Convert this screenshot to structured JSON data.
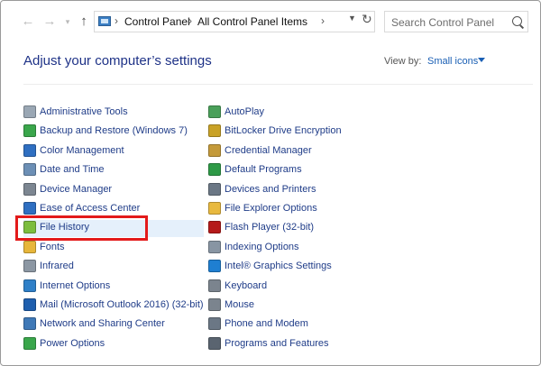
{
  "nav": {
    "back_icon": "arrow-left-icon",
    "forward_icon": "arrow-right-icon",
    "recent_icon": "chevron-down-icon",
    "up_icon": "arrow-up-icon"
  },
  "address": {
    "breadcrumbs": [
      "Control Panel",
      "All Control Panel Items"
    ],
    "separator": "›"
  },
  "search": {
    "placeholder": "Search Control Panel"
  },
  "header": {
    "title": "Adjust your computer’s settings",
    "view_by_label": "View by:",
    "view_by_value": "Small icons"
  },
  "items": {
    "left": [
      {
        "label": "Administrative Tools",
        "icon": "tools-gear-icon",
        "color": "#9aa7b4"
      },
      {
        "label": "Backup and Restore (Windows 7)",
        "icon": "backup-icon",
        "color": "#3aa64b"
      },
      {
        "label": "Color Management",
        "icon": "color-monitor-icon",
        "color": "#2f6fc1"
      },
      {
        "label": "Date and Time",
        "icon": "clock-calendar-icon",
        "color": "#6c8fb5"
      },
      {
        "label": "Device Manager",
        "icon": "device-manager-icon",
        "color": "#7c8691"
      },
      {
        "label": "Ease of Access Center",
        "icon": "ease-of-access-icon",
        "color": "#2f6fc1"
      },
      {
        "label": "File History",
        "icon": "file-history-icon",
        "color": "#7cbd3e"
      },
      {
        "label": "Fonts",
        "icon": "fonts-icon",
        "color": "#e7b63a"
      },
      {
        "label": "Infrared",
        "icon": "infrared-icon",
        "color": "#8c97a3"
      },
      {
        "label": "Internet Options",
        "icon": "globe-icon",
        "color": "#2f80c8"
      },
      {
        "label": "Mail (Microsoft Outlook 2016) (32-bit)",
        "icon": "mail-icon",
        "color": "#1f5fae"
      },
      {
        "label": "Network and Sharing Center",
        "icon": "network-icon",
        "color": "#3f79b7"
      },
      {
        "label": "Power Options",
        "icon": "power-icon",
        "color": "#3aa64b"
      }
    ],
    "right": [
      {
        "label": "AutoPlay",
        "icon": "autoplay-icon",
        "color": "#4aa05a"
      },
      {
        "label": "BitLocker Drive Encryption",
        "icon": "bitlocker-icon",
        "color": "#c9a227"
      },
      {
        "label": "Credential Manager",
        "icon": "credential-safe-icon",
        "color": "#c49a3a"
      },
      {
        "label": "Default Programs",
        "icon": "default-programs-icon",
        "color": "#2e9a47"
      },
      {
        "label": "Devices and Printers",
        "icon": "printer-icon",
        "color": "#6b7785"
      },
      {
        "label": "File Explorer Options",
        "icon": "folder-options-icon",
        "color": "#e8b93f"
      },
      {
        "label": "Flash Player (32-bit)",
        "icon": "flash-player-icon",
        "color": "#b51a1a"
      },
      {
        "label": "Indexing Options",
        "icon": "indexing-search-icon",
        "color": "#8895a3"
      },
      {
        "label": "Intel® Graphics Settings",
        "icon": "intel-graphics-icon",
        "color": "#1f7fd1"
      },
      {
        "label": "Keyboard",
        "icon": "keyboard-icon",
        "color": "#7b848e"
      },
      {
        "label": "Mouse",
        "icon": "mouse-icon",
        "color": "#7b848e"
      },
      {
        "label": "Phone and Modem",
        "icon": "phone-modem-icon",
        "color": "#6b7785"
      },
      {
        "label": "Programs and Features",
        "icon": "programs-features-icon",
        "color": "#5a6470"
      }
    ]
  },
  "highlight": {
    "item": "File History",
    "color": "#e31a1a"
  },
  "colors": {
    "link": "#1f3c88",
    "title": "#1e3287",
    "accent": "#1a5fb4"
  }
}
